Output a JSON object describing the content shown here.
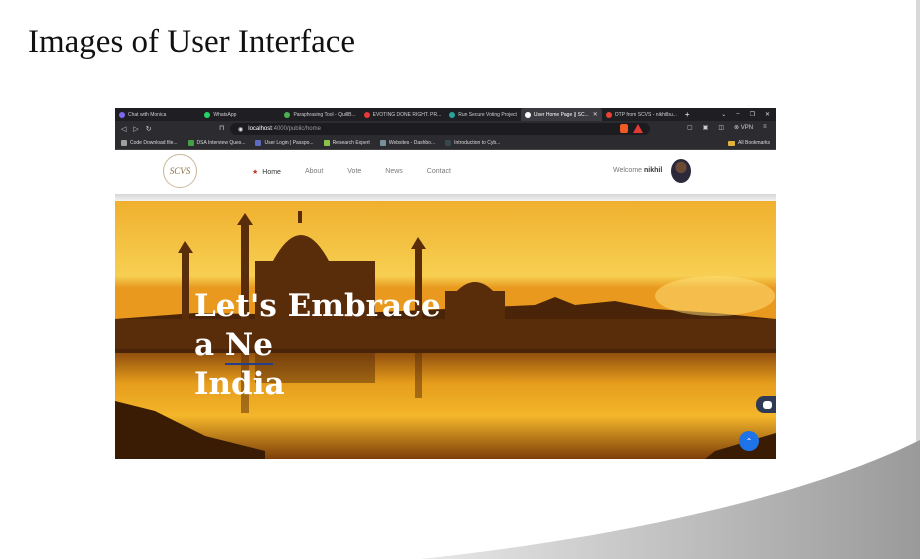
{
  "slide": {
    "title": "Images of User Interface"
  },
  "browser": {
    "tabs": [
      {
        "label": "Chat with Monica",
        "color": "#7b68ee"
      },
      {
        "label": "WhatsApp",
        "color": "#25d366"
      },
      {
        "label": "Paraphrasing Tool - QuillB...",
        "color": "#4caf50"
      },
      {
        "label": "EVOTING DONE RIGHT. PR...",
        "color": "#e53935"
      },
      {
        "label": "Run Secure Voting Project",
        "color": "#26a69a"
      },
      {
        "label": "User Home Page || SC...",
        "color": "#ffffff",
        "active": true
      },
      {
        "label": "OTP from SCVS - nikhilbu...",
        "color": "#ea4335"
      }
    ],
    "new_tab": "+",
    "url_host": "localhost",
    "url_path": ":4000/public/home",
    "vpn_label": "VPN",
    "bookmarks": [
      {
        "label": "Code Download file...",
        "color": "#9e9e9e"
      },
      {
        "label": "DSA Interview Ques...",
        "color": "#43a047"
      },
      {
        "label": "User Login | Passpo...",
        "color": "#5c6bc0"
      },
      {
        "label": "Research Expert",
        "color": "#8bc34a"
      },
      {
        "label": "Websites - Dashbo...",
        "color": "#78909c"
      },
      {
        "label": "Introduction to Cyb...",
        "color": "#37474f"
      }
    ],
    "all_bookmarks": "All Bookmarks"
  },
  "site": {
    "logo_text": "SCVS",
    "nav": [
      "Home",
      "About",
      "Vote",
      "News",
      "Contact"
    ],
    "welcome_prefix": "Welcome",
    "username": "nikhil"
  },
  "hero": {
    "line1": "Let's Embrace",
    "line2_a": "a ",
    "line2_b": "Ne",
    "line3": "India"
  }
}
